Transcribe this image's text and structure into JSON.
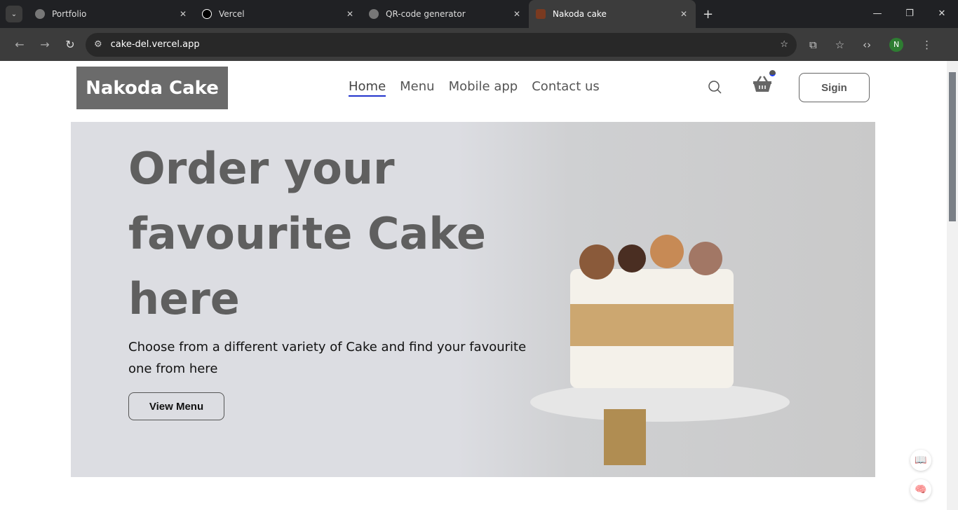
{
  "browser": {
    "tabs": [
      {
        "title": "Portfolio"
      },
      {
        "title": "Vercel"
      },
      {
        "title": "QR-code generator"
      },
      {
        "title": "Nakoda cake",
        "active": true
      }
    ],
    "url": "cake-del.vercel.app",
    "profile_initial": "N"
  },
  "site": {
    "logo": "Nakoda Cake",
    "menu": [
      "Home",
      "Menu",
      "Mobile app",
      "Contact us"
    ],
    "signin": "Sigin",
    "hero": {
      "line1": "Order your",
      "line2": "favourite Cake",
      "line3": "here",
      "subtitle": "Choose from a different variety of Cake and find your favourite one from here",
      "button": "View Menu"
    }
  }
}
